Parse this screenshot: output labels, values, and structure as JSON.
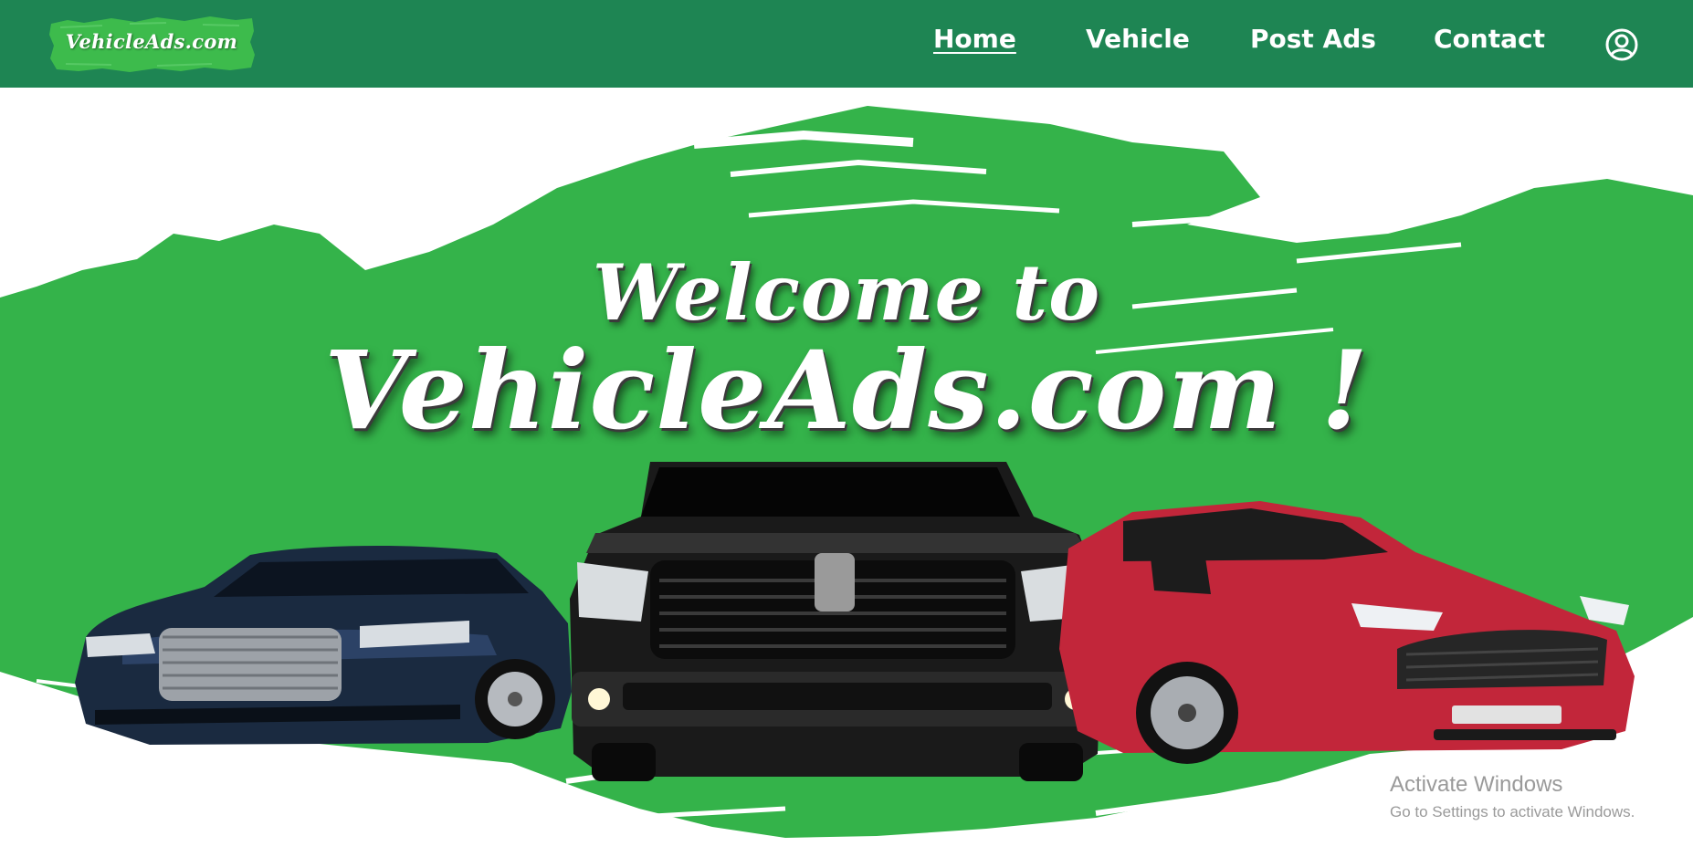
{
  "header": {
    "logo_text": "VehicleAds.com",
    "nav": {
      "home": "Home",
      "vehicle": "Vehicle",
      "post_ads": "Post Ads",
      "contact": "Contact"
    },
    "profile_icon": "user-circle-icon"
  },
  "hero": {
    "welcome": "Welcome to",
    "brand": "VehicleAds.com !",
    "cars": [
      "blue-sedan",
      "black-pickup-truck",
      "red-suv"
    ]
  },
  "watermark": {
    "title": "Activate Windows",
    "subtitle": "Go to Settings to activate Windows."
  },
  "colors": {
    "navbar": "#1e8553",
    "brush_green": "#34b34a",
    "text": "#ffffff"
  }
}
